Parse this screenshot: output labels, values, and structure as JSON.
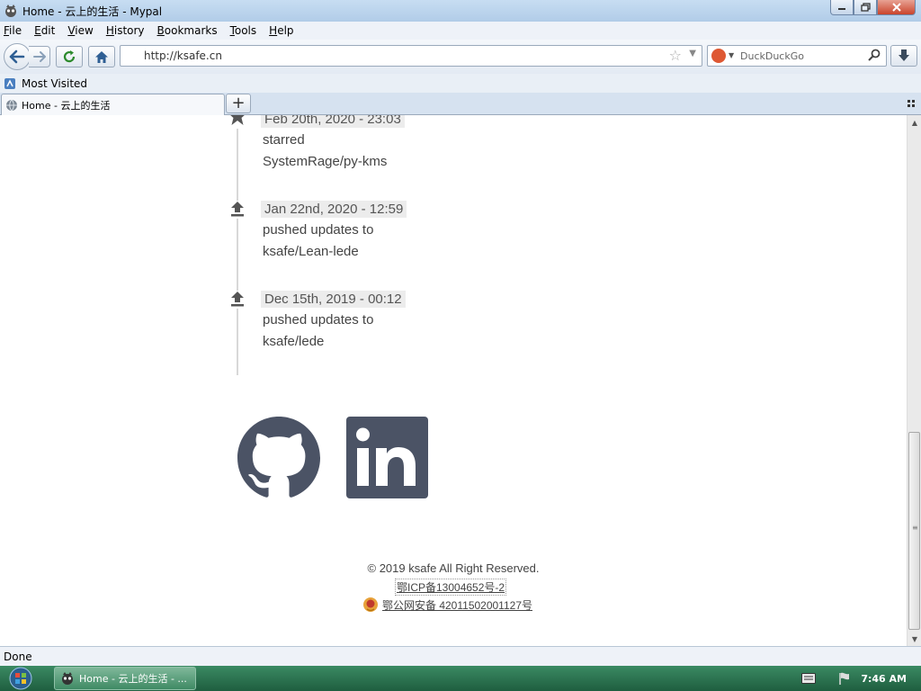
{
  "window": {
    "title": "Home - 云上的生活 - Mypal"
  },
  "menu": [
    "File",
    "Edit",
    "View",
    "History",
    "Bookmarks",
    "Tools",
    "Help"
  ],
  "nav": {
    "url": "http://ksafe.cn",
    "search_placeholder": "DuckDuckGo"
  },
  "bookmarks": {
    "most_visited": "Most Visited"
  },
  "tab": {
    "title": "Home - 云上的生活"
  },
  "timeline": [
    {
      "icon": "star",
      "date": "Feb 20th, 2020 - 23:03",
      "action": "starred",
      "repo": "SystemRage/py-kms"
    },
    {
      "icon": "push",
      "date": "Jan 22nd, 2020 - 12:59",
      "action": "pushed updates to",
      "repo": "ksafe/Lean-lede"
    },
    {
      "icon": "push",
      "date": "Dec 15th, 2019 - 00:12",
      "action": "pushed updates to",
      "repo": "ksafe/lede"
    }
  ],
  "footer": {
    "copyright": "© 2019 ksafe All Right Reserved.",
    "icp": "鄂ICP备13004652号-2",
    "police": "鄂公网安备 42011502001127号"
  },
  "status": {
    "text": "Done"
  },
  "taskbar": {
    "task_title": "Home - 云上的生活 - ...",
    "clock": "7:46 AM"
  },
  "colors": {
    "social_icon": "#4b5365",
    "taskbar": "#2d7552",
    "date_bg": "#ececec"
  }
}
